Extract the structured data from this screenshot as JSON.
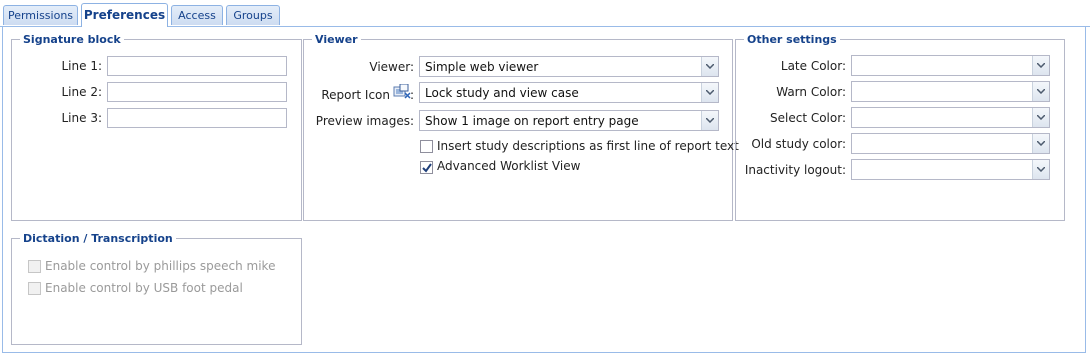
{
  "tabs": [
    {
      "label": "Permissions"
    },
    {
      "label": "Preferences"
    },
    {
      "label": "Access"
    },
    {
      "label": "Groups"
    }
  ],
  "signature": {
    "legend": "Signature block",
    "line1_label": "Line 1:",
    "line2_label": "Line 2:",
    "line3_label": "Line 3:",
    "line1_value": "",
    "line2_value": "",
    "line3_value": ""
  },
  "viewer": {
    "legend": "Viewer",
    "viewer_label": "Viewer:",
    "viewer_value": "Simple web viewer",
    "report_icon_label": "Report Icon",
    "report_icon_colon": ":",
    "report_icon_value": "Lock study and view case",
    "preview_label": "Preview images:",
    "preview_value": "Show 1 image on report entry page",
    "insert_desc_label": "Insert study descriptions as first line of report text",
    "insert_desc_checked": false,
    "advanced_worklist_label": "Advanced Worklist View",
    "advanced_worklist_checked": true
  },
  "other": {
    "legend": "Other settings",
    "late_color_label": "Late Color:",
    "warn_color_label": "Warn Color:",
    "select_color_label": "Select Color:",
    "old_study_color_label": "Old study color:",
    "inactivity_logout_label": "Inactivity logout:",
    "late_color_value": "",
    "warn_color_value": "",
    "select_color_value": "",
    "old_study_color_value": "",
    "inactivity_logout_value": ""
  },
  "dictation": {
    "legend": "Dictation / Transcription",
    "phillips_label": "Enable control by phillips speech mike",
    "phillips_checked": false,
    "foot_pedal_label": "Enable control by USB foot pedal",
    "foot_pedal_checked": false
  },
  "icons": {
    "combo_trigger": "chevron-down-icon",
    "checkbox_mark": "check-icon",
    "report_icon": "report-lock-icon"
  },
  "colors": {
    "accent": "#15428b",
    "tab_border": "#8db2e3",
    "panel_border": "#99bbe8",
    "field_border": "#b5b8c8",
    "disabled_text": "#9a9a9a"
  }
}
